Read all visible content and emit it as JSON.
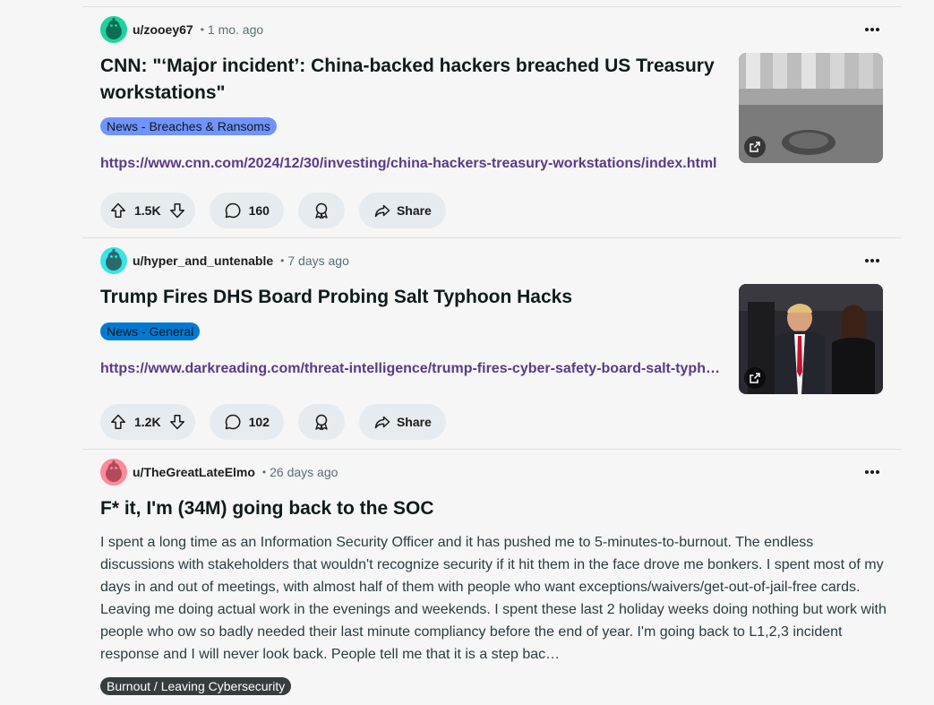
{
  "posts": [
    {
      "username": "u/zooey67",
      "separator": "•",
      "time": "1 mo. ago",
      "title": "CNN: \"‘Major incident’: China-backed hackers breached US Treasury workstations\"",
      "flair": "News - Breaches & Ransoms",
      "flair_color": "#7193ff",
      "link": "https://www.cnn.com/2024/12/30/investing/china-hackers-treasury-workstations/index.html",
      "upvotes": "1.5K",
      "comments": "160",
      "share_label": "Share",
      "avatar_color": "#1ed39e",
      "thumbnail_icon": "external-link-icon"
    },
    {
      "username": "u/hyper_and_untenable",
      "separator": "•",
      "time": "7 days ago",
      "title": "Trump Fires DHS Board Probing Salt Typhoon Hacks",
      "flair": "News - General",
      "flair_color": "#0079d3",
      "link": "https://www.darkreading.com/threat-intelligence/trump-fires-cyber-safety-board-salt-typhoon",
      "upvotes": "1.2K",
      "comments": "102",
      "share_label": "Share",
      "avatar_color": "#3be4e4",
      "thumbnail_icon": "external-link-icon"
    },
    {
      "username": "u/TheGreatLateElmo",
      "separator": "•",
      "time": "26 days ago",
      "title": "F* it, I'm (34M) going back to the SOC",
      "body": "I spent a long time as an Information Security Officer and it has pushed me to 5-minutes-to-burnout. The endless discussions with stakeholders that wouldn't recognize security if it hit them in the face drove me bonkers. I spent most of my days in and out of meetings, with almost half of them with people who want exceptions/waivers/get-out-of-jail-free cards. Leaving me doing actual work in the evenings and weekends. I spent these last 2 holiday weeks doing nothing but work with people who ow so badly needed their last minute compliancy before the end of year. I'm going back to L1,2,3 incident response and I will never look back. People tell me that it is a step bac…",
      "flair": "Burnout / Leaving Cybersecurity",
      "flair_color": "#373c3f",
      "avatar_color": "#ff8a9a"
    }
  ]
}
